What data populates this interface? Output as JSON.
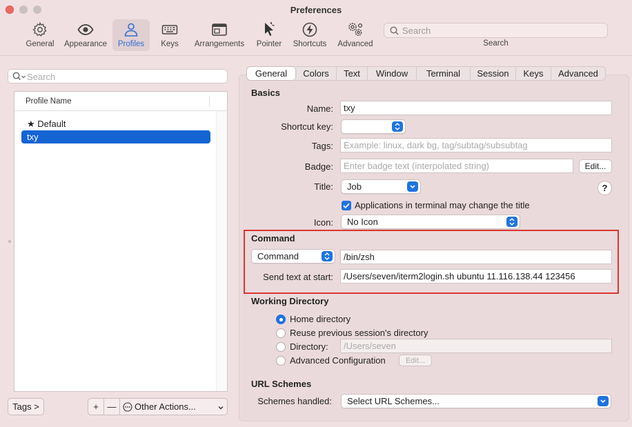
{
  "window": {
    "title": "Preferences"
  },
  "toolbar": {
    "items": [
      {
        "label": "General",
        "icon": "gear-icon"
      },
      {
        "label": "Appearance",
        "icon": "eye-icon"
      },
      {
        "label": "Profiles",
        "icon": "person-icon",
        "selected": true
      },
      {
        "label": "Keys",
        "icon": "keyboard-icon"
      },
      {
        "label": "Arrangements",
        "icon": "window-icon"
      },
      {
        "label": "Pointer",
        "icon": "pointer-icon"
      },
      {
        "label": "Shortcuts",
        "icon": "bolt-icon"
      },
      {
        "label": "Advanced",
        "icon": "gears-icon"
      }
    ],
    "search_placeholder": "Search",
    "search_label": "Search"
  },
  "profiles": {
    "search_placeholder": "Search",
    "column_header": "Profile Name",
    "rows": [
      {
        "label": "★ Default",
        "selected": false
      },
      {
        "label": "txy",
        "selected": true
      }
    ],
    "tags_button": "Tags >",
    "add_button": "+",
    "remove_button": "—",
    "other_actions": "Other Actions..."
  },
  "tabs": [
    "General",
    "Colors",
    "Text",
    "Window",
    "Terminal",
    "Session",
    "Keys",
    "Advanced"
  ],
  "basics": {
    "title": "Basics",
    "name_label": "Name:",
    "name_value": "txy",
    "shortcut_label": "Shortcut key:",
    "shortcut_value": "",
    "tags_label": "Tags:",
    "tags_placeholder": "Example: linux, dark bg, tag/subtag/subsubtag",
    "badge_label": "Badge:",
    "badge_placeholder": "Enter badge text (interpolated string)",
    "badge_edit": "Edit...",
    "title_label": "Title:",
    "title_value": "Job",
    "help": "?",
    "title_checkbox": "Applications in terminal may change the title",
    "icon_label": "Icon:",
    "icon_value": "No Icon"
  },
  "command": {
    "title": "Command",
    "mode_value": "Command",
    "command_value": "/bin/zsh",
    "send_text_label": "Send text at start:",
    "send_text_value": "/Users/seven/iterm2login.sh ubuntu 11.116.138.44 123456"
  },
  "working_directory": {
    "title": "Working Directory",
    "options": [
      "Home directory",
      "Reuse previous session's directory",
      "Directory:",
      "Advanced Configuration"
    ],
    "selected_index": 0,
    "directory_placeholder": "/Users/seven",
    "edit": "Edit..."
  },
  "url_schemes": {
    "title": "URL Schemes",
    "label": "Schemes handled:",
    "value": "Select URL Schemes..."
  },
  "colors": {
    "accent": "#1e73e0",
    "highlight_border": "#d9362f",
    "selection": "#1464d2"
  }
}
